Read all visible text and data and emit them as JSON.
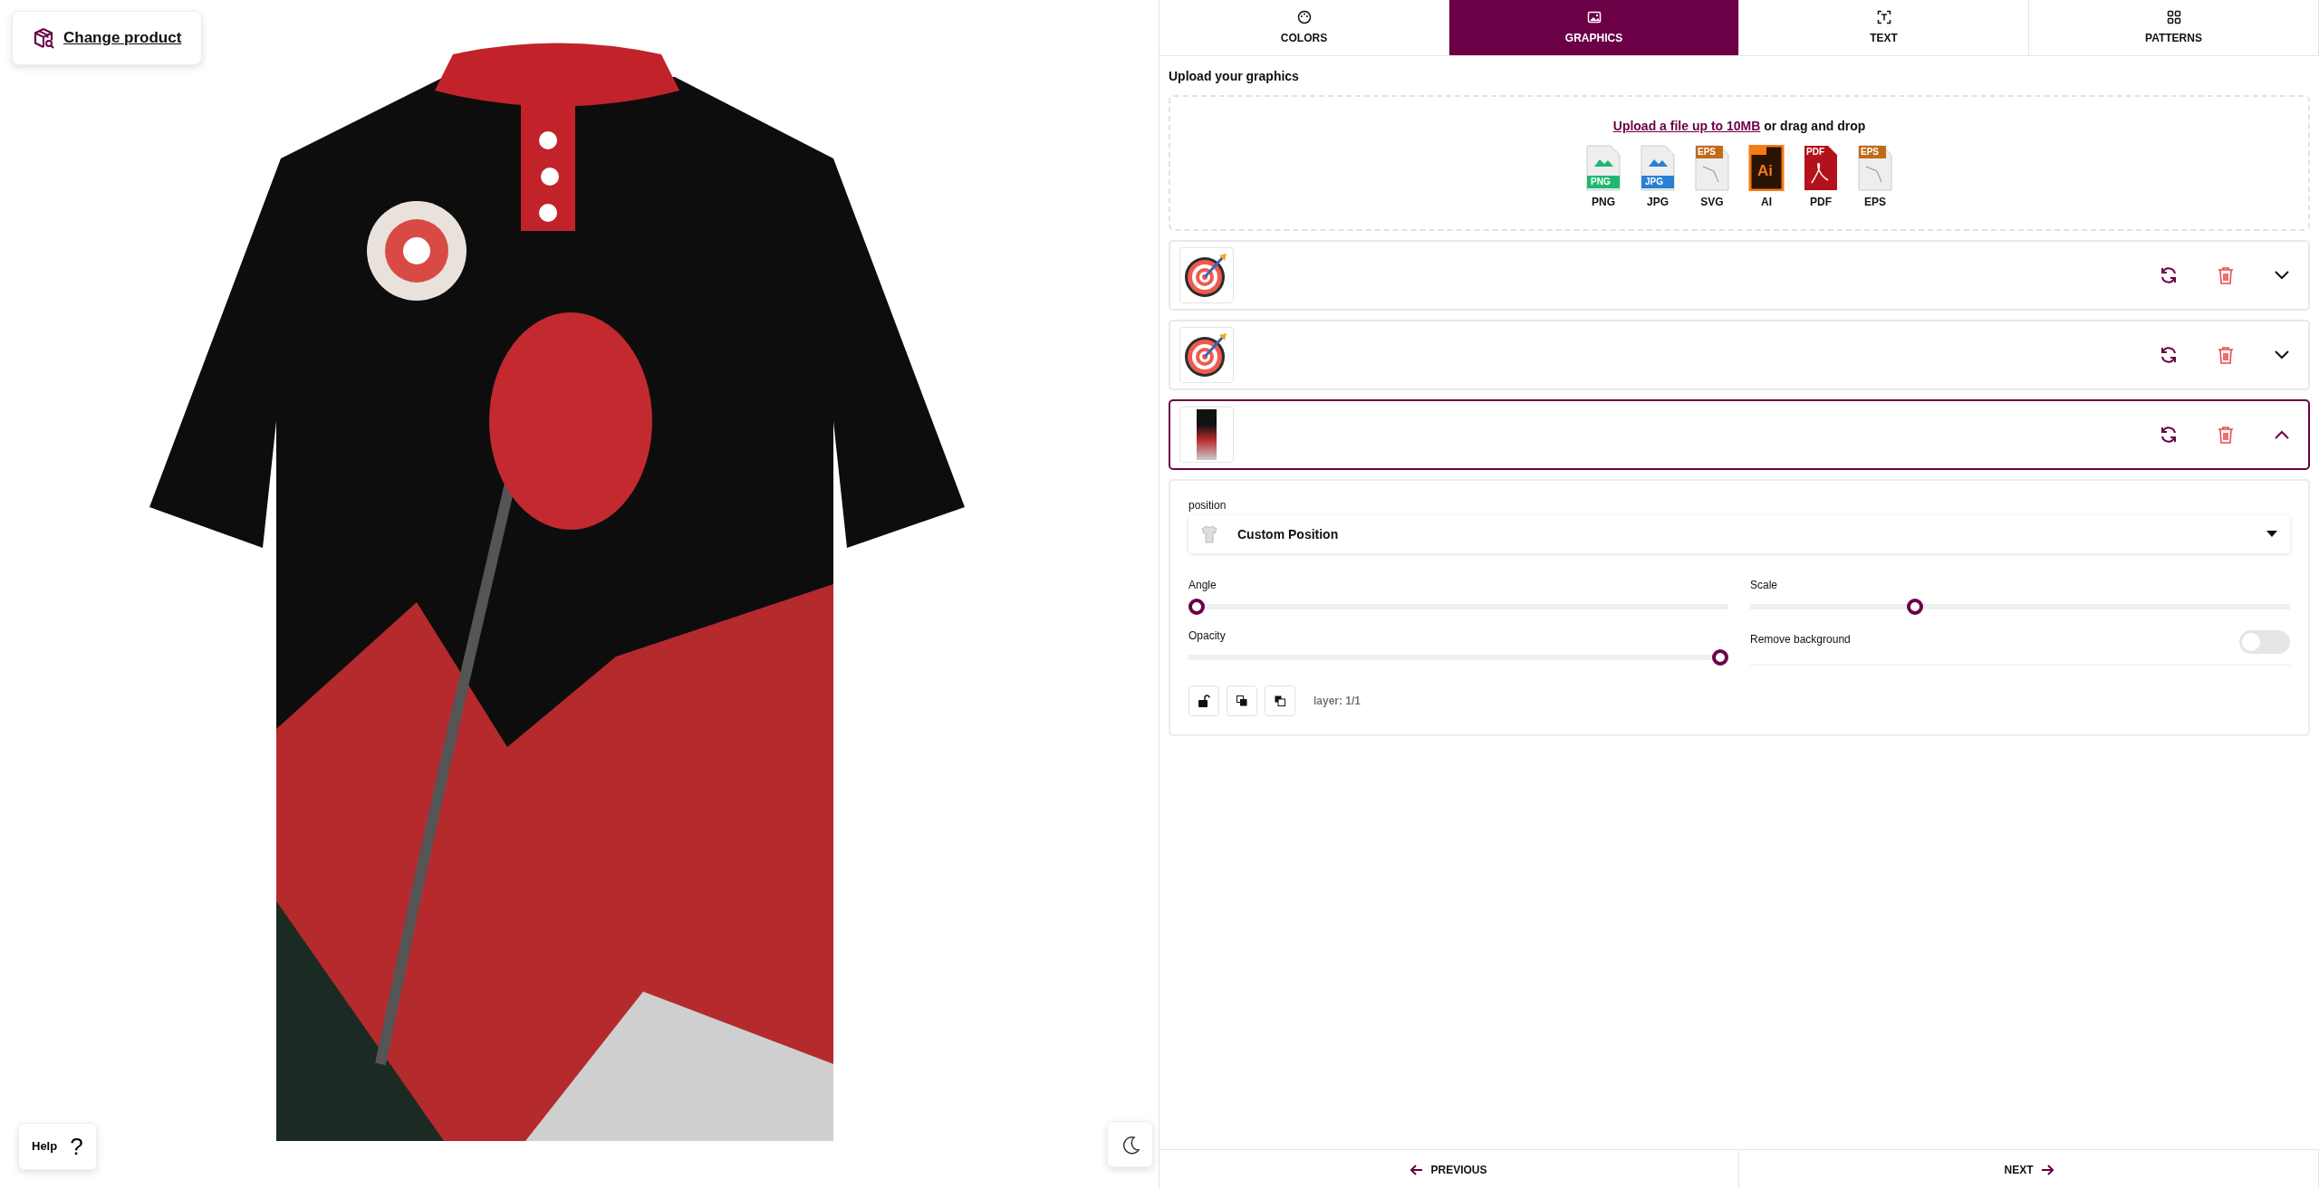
{
  "header": {
    "change_product": "Change product"
  },
  "tabs": [
    {
      "label": "COLORS",
      "selected": false
    },
    {
      "label": "GRAPHICS",
      "selected": true
    },
    {
      "label": "TEXT",
      "selected": false
    },
    {
      "label": "PATTERNS",
      "selected": false
    }
  ],
  "upload": {
    "heading": "Upload your graphics",
    "link": "Upload a file up to 10MB",
    "rest": "or drag and drop",
    "file_types": [
      {
        "label": "PNG",
        "badge": "PNG",
        "kind": "image",
        "color": "#1fb86e"
      },
      {
        "label": "JPG",
        "badge": "JPG",
        "kind": "image",
        "color": "#2a7fd4"
      },
      {
        "label": "SVG",
        "badge": "EPS",
        "kind": "vector",
        "color": "#c06a1a"
      },
      {
        "label": "AI",
        "badge": "Ai",
        "kind": "ai",
        "color": "#f37b14"
      },
      {
        "label": "PDF",
        "badge": "PDF",
        "kind": "pdf",
        "color": "#b3121c"
      },
      {
        "label": "EPS",
        "badge": "EPS",
        "kind": "vector",
        "color": "#c06a1a"
      }
    ]
  },
  "layers": [
    {
      "kind": "target",
      "expanded": false,
      "selected": false
    },
    {
      "kind": "target",
      "expanded": false,
      "selected": false
    },
    {
      "kind": "artwork",
      "expanded": true,
      "selected": true
    }
  ],
  "details": {
    "position_label": "position",
    "position_value": "Custom Position",
    "sliders": [
      {
        "label": "Angle",
        "level": 0
      },
      {
        "label": "Scale",
        "level": 0.3
      },
      {
        "label": "Opacity",
        "level": 1
      }
    ],
    "remove_background": {
      "label": "Remove background",
      "on": false
    },
    "layer_text": "layer: 1/1"
  },
  "footer": {
    "previous": "PREVIOUS",
    "next": "NEXT"
  },
  "help": {
    "label": "Help",
    "icon_char": "?"
  }
}
